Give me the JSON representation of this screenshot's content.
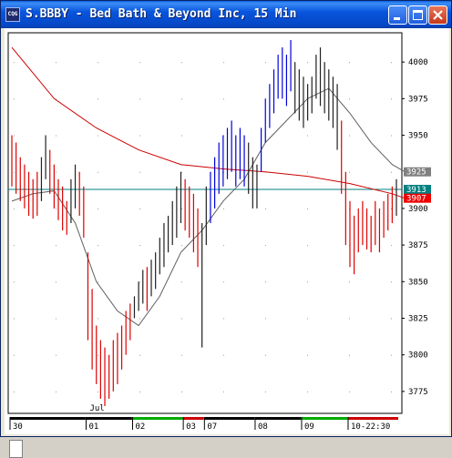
{
  "window": {
    "title": "S.BBBY - Bed Bath & Beyond Inc, 15 Min",
    "app_icon_text": "CQG",
    "buttons": [
      {
        "name": "minimize-button",
        "icon": "minimize-icon"
      },
      {
        "name": "maximize-button",
        "icon": "maximize-icon"
      },
      {
        "name": "close-button",
        "icon": "close-icon"
      }
    ]
  },
  "colors": {
    "bars_up": "#0000dd",
    "bars_neutral": "#202020",
    "bars_down": "#dd0000",
    "ma_slow": "#cc0000",
    "ma_fast": "#606060",
    "last_line": "#008080",
    "marker_gray": "#808080",
    "marker_teal": "#008080",
    "marker_red": "#ee0000"
  },
  "chart_data": {
    "type": "bar",
    "symbol": "S.BBBY",
    "interval": "15 Min",
    "ylim": [
      3760,
      4020
    ],
    "yticks": [
      {
        "label": "4000",
        "value": 4000
      },
      {
        "label": "3975",
        "value": 3975
      },
      {
        "label": "3950",
        "value": 3950
      },
      {
        "label": "3900",
        "value": 3900
      },
      {
        "label": "3875",
        "value": 3875
      },
      {
        "label": "3850",
        "value": 3850
      },
      {
        "label": "3825",
        "value": 3825
      },
      {
        "label": "3800",
        "value": 3800
      },
      {
        "label": "3775",
        "value": 3775
      }
    ],
    "markers": [
      {
        "label": "3925",
        "value": 3925,
        "color": "gray"
      },
      {
        "label": "3913",
        "value": 3913,
        "color": "teal"
      },
      {
        "label": "3907",
        "value": 3907,
        "color": "red"
      }
    ],
    "last_price": 3913,
    "month_label": "Jul",
    "sessions": [
      {
        "label": "30",
        "bars": 18
      },
      {
        "label": "01",
        "bars": 11
      },
      {
        "label": "02",
        "bars": 12
      },
      {
        "label": "03",
        "bars": 5
      },
      {
        "label": "07",
        "bars": 12
      },
      {
        "label": "08",
        "bars": 11
      },
      {
        "label": "09",
        "bars": 11
      },
      {
        "label": "10-22:30",
        "bars": 12
      }
    ],
    "series": [
      {
        "kind": "ohlc",
        "highs": [
          3950,
          3945,
          3935,
          3930,
          3925,
          3920,
          3925,
          3935,
          3950,
          3940,
          3930,
          3920,
          3915,
          3905,
          3920,
          3930,
          3925,
          3915,
          3870,
          3845,
          3820,
          3810,
          3805,
          3800,
          3810,
          3815,
          3820,
          3830,
          3835,
          3840,
          3850,
          3858,
          3860,
          3865,
          3870,
          3880,
          3890,
          3895,
          3905,
          3915,
          3925,
          3920,
          3915,
          3910,
          3900,
          3890,
          3915,
          3925,
          3935,
          3945,
          3950,
          3955,
          3960,
          3950,
          3955,
          3950,
          3945,
          3935,
          3930,
          3955,
          3975,
          3985,
          3995,
          4005,
          4010,
          4005,
          4015,
          4000,
          3995,
          3990,
          3985,
          3990,
          4005,
          4010,
          4000,
          3995,
          3990,
          3985,
          3960,
          3925,
          3905,
          3895,
          3900,
          3905,
          3900,
          3895,
          3905,
          3900,
          3905,
          3910,
          3915,
          3920
        ],
        "lows": [
          3915,
          3910,
          3905,
          3900,
          3895,
          3893,
          3895,
          3905,
          3920,
          3910,
          3900,
          3892,
          3885,
          3882,
          3890,
          3900,
          3895,
          3880,
          3810,
          3790,
          3780,
          3770,
          3765,
          3770,
          3775,
          3780,
          3790,
          3800,
          3810,
          3825,
          3830,
          3835,
          3830,
          3840,
          3845,
          3855,
          3860,
          3870,
          3875,
          3880,
          3890,
          3885,
          3880,
          3870,
          3860,
          3805,
          3875,
          3890,
          3900,
          3910,
          3915,
          3920,
          3925,
          3915,
          3920,
          3915,
          3910,
          3900,
          3900,
          3925,
          3945,
          3955,
          3965,
          3975,
          3975,
          3970,
          3980,
          3965,
          3960,
          3955,
          3960,
          3965,
          3975,
          3970,
          3965,
          3960,
          3955,
          3940,
          3910,
          3875,
          3860,
          3855,
          3870,
          3875,
          3872,
          3870,
          3875,
          3870,
          3880,
          3885,
          3890,
          3895
        ],
        "colors": [
          "down",
          "down",
          "down",
          "down",
          "down",
          "down",
          "down",
          "neutral",
          "neutral",
          "down",
          "down",
          "down",
          "down",
          "down",
          "neutral",
          "neutral",
          "down",
          "down",
          "down",
          "down",
          "down",
          "down",
          "down",
          "down",
          "down",
          "down",
          "down",
          "down",
          "down",
          "neutral",
          "neutral",
          "neutral",
          "down",
          "neutral",
          "neutral",
          "neutral",
          "neutral",
          "neutral",
          "neutral",
          "neutral",
          "neutral",
          "down",
          "down",
          "down",
          "down",
          "neutral",
          "neutral",
          "up",
          "up",
          "up",
          "up",
          "up",
          "up",
          "up",
          "up",
          "up",
          "neutral",
          "neutral",
          "neutral",
          "up",
          "up",
          "up",
          "up",
          "up",
          "up",
          "up",
          "up",
          "neutral",
          "neutral",
          "neutral",
          "neutral",
          "neutral",
          "neutral",
          "neutral",
          "neutral",
          "neutral",
          "neutral",
          "neutral",
          "down",
          "down",
          "down",
          "down",
          "down",
          "down",
          "down",
          "down",
          "down",
          "down",
          "down",
          "down",
          "down",
          "neutral"
        ]
      },
      {
        "kind": "ma_slow",
        "x_index": [
          0,
          10,
          20,
          30,
          40,
          50,
          60,
          70,
          80,
          90,
          93
        ],
        "values": [
          4010,
          3975,
          3955,
          3940,
          3930,
          3927,
          3925,
          3922,
          3917,
          3910,
          3907
        ]
      },
      {
        "kind": "ma_fast",
        "x_index": [
          0,
          5,
          10,
          15,
          20,
          25,
          30,
          35,
          40,
          45,
          50,
          55,
          60,
          65,
          70,
          75,
          80,
          85,
          90,
          93
        ],
        "values": [
          3905,
          3910,
          3912,
          3890,
          3850,
          3830,
          3820,
          3840,
          3870,
          3885,
          3905,
          3920,
          3945,
          3960,
          3975,
          3982,
          3965,
          3945,
          3930,
          3925
        ]
      }
    ]
  }
}
